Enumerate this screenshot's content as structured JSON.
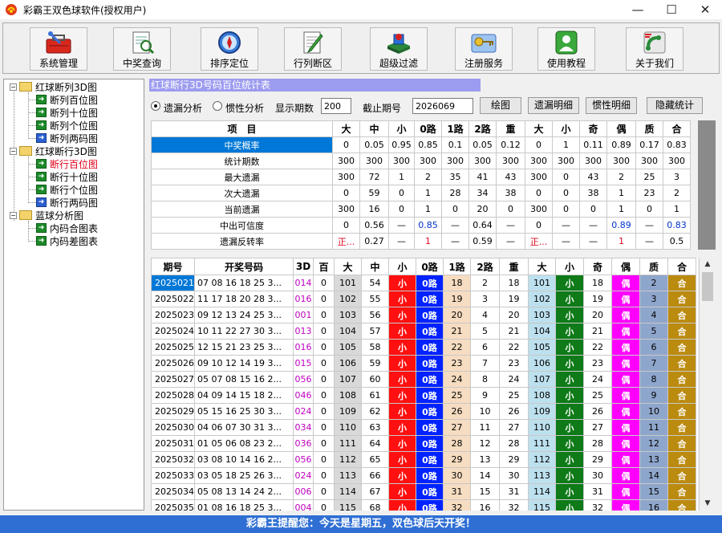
{
  "window": {
    "title": "彩霸王双色球软件(授权用户)",
    "minimize_glyph": "—",
    "maximize_glyph": "☐",
    "close_glyph": "✕"
  },
  "toolbar": {
    "items": [
      {
        "label": "系统管理",
        "icon": "toolbox-icon"
      },
      {
        "label": "中奖查询",
        "icon": "search-document-icon"
      },
      {
        "label": "排序定位",
        "icon": "compass-icon"
      },
      {
        "label": "行列断区",
        "icon": "edit-document-icon"
      },
      {
        "label": "超级过滤",
        "icon": "filter-blocks-icon"
      },
      {
        "label": "注册服务",
        "icon": "key-icon"
      },
      {
        "label": "使用教程",
        "icon": "user-icon"
      },
      {
        "label": "关于我们",
        "icon": "phone-icon"
      }
    ]
  },
  "tree": {
    "groups": [
      {
        "label": "红球断列3D图",
        "expand": "−",
        "items": [
          "断列百位图",
          "断列十位图",
          "断列个位图",
          "断列两码图"
        ]
      },
      {
        "label": "红球断行3D图",
        "expand": "−",
        "items": [
          "断行百位图",
          "断行十位图",
          "断行个位图",
          "断行两码图"
        ]
      },
      {
        "label": "蓝球分析图",
        "expand": "−",
        "items": [
          "内码合图表",
          "内码差图表"
        ]
      }
    ],
    "selected": "断行百位图"
  },
  "banner": "红球断行3D号码百位统计表",
  "options": {
    "radio1": "遗漏分析",
    "radio2": "惯性分析",
    "selected": "遗漏分析",
    "count_label": "显示期数",
    "count_value": "200",
    "period_label": "截止期号",
    "period_value": "2026069",
    "buttons": [
      "绘图",
      "遗漏明细",
      "惯性明细",
      "隐藏统计"
    ]
  },
  "stat": {
    "headers": [
      "项　目",
      "大",
      "中",
      "小",
      "0路",
      "1路",
      "2路",
      "重",
      "大",
      "小",
      "奇",
      "偶",
      "质",
      "合"
    ],
    "rows": [
      [
        "中奖概率",
        "0",
        "0.05",
        "0.95",
        "0.85",
        "0.1",
        "0.05",
        "0.12",
        "0",
        "1",
        "0.11",
        "0.89",
        "0.17",
        "0.83"
      ],
      [
        "统计期数",
        "300",
        "300",
        "300",
        "300",
        "300",
        "300",
        "300",
        "300",
        "300",
        "300",
        "300",
        "300",
        "300"
      ],
      [
        "最大遗漏",
        "300",
        "72",
        "1",
        "2",
        "35",
        "41",
        "43",
        "300",
        "0",
        "43",
        "2",
        "25",
        "3"
      ],
      [
        "次大遗漏",
        "0",
        "59",
        "0",
        "1",
        "28",
        "34",
        "38",
        "0",
        "0",
        "38",
        "1",
        "23",
        "2"
      ],
      [
        "当前遗漏",
        "300",
        "16",
        "0",
        "1",
        "0",
        "20",
        "0",
        "300",
        "0",
        "0",
        "1",
        "0",
        "1"
      ],
      [
        "中出可信度",
        "0",
        "0.56",
        "—",
        "0.85",
        "—",
        "0.64",
        "—",
        "0",
        "—",
        "—",
        "0.89",
        "—",
        "0.83"
      ],
      [
        "遗漏反转率",
        "正...",
        "0.27",
        "—",
        "1",
        "—",
        "0.59",
        "—",
        "正...",
        "—",
        "—",
        "1",
        "—",
        "0.5"
      ]
    ]
  },
  "data": {
    "headers": [
      "期号",
      "开奖号码",
      "3D",
      "百",
      "大",
      "中",
      "小",
      "0路",
      "1路",
      "2路",
      "重",
      "大",
      "小",
      "奇",
      "偶",
      "质",
      "合"
    ],
    "rows": [
      [
        "2025021",
        "07 08 16 18 25 3...",
        "014",
        "0",
        "101",
        "54",
        "小",
        "0路",
        "18",
        "2",
        "18",
        "101",
        "小",
        "18",
        "偶",
        "2",
        "合"
      ],
      [
        "2025022",
        "11 17 18 20 28 3...",
        "016",
        "0",
        "102",
        "55",
        "小",
        "0路",
        "19",
        "3",
        "19",
        "102",
        "小",
        "19",
        "偶",
        "3",
        "合"
      ],
      [
        "2025023",
        "09 12 13 24 25 3...",
        "001",
        "0",
        "103",
        "56",
        "小",
        "0路",
        "20",
        "4",
        "20",
        "103",
        "小",
        "20",
        "偶",
        "4",
        "合"
      ],
      [
        "2025024",
        "10 11 22 27 30 3...",
        "013",
        "0",
        "104",
        "57",
        "小",
        "0路",
        "21",
        "5",
        "21",
        "104",
        "小",
        "21",
        "偶",
        "5",
        "合"
      ],
      [
        "2025025",
        "12 15 21 23 25 3...",
        "016",
        "0",
        "105",
        "58",
        "小",
        "0路",
        "22",
        "6",
        "22",
        "105",
        "小",
        "22",
        "偶",
        "6",
        "合"
      ],
      [
        "2025026",
        "09 10 12 14 19 3...",
        "015",
        "0",
        "106",
        "59",
        "小",
        "0路",
        "23",
        "7",
        "23",
        "106",
        "小",
        "23",
        "偶",
        "7",
        "合"
      ],
      [
        "2025027",
        "05 07 08 15 16 2...",
        "056",
        "0",
        "107",
        "60",
        "小",
        "0路",
        "24",
        "8",
        "24",
        "107",
        "小",
        "24",
        "偶",
        "8",
        "合"
      ],
      [
        "2025028",
        "04 09 14 15 18 2...",
        "046",
        "0",
        "108",
        "61",
        "小",
        "0路",
        "25",
        "9",
        "25",
        "108",
        "小",
        "25",
        "偶",
        "9",
        "合"
      ],
      [
        "2025029",
        "05 15 16 25 30 3...",
        "024",
        "0",
        "109",
        "62",
        "小",
        "0路",
        "26",
        "10",
        "26",
        "109",
        "小",
        "26",
        "偶",
        "10",
        "合"
      ],
      [
        "2025030",
        "04 06 07 30 31 3...",
        "034",
        "0",
        "110",
        "63",
        "小",
        "0路",
        "27",
        "11",
        "27",
        "110",
        "小",
        "27",
        "偶",
        "11",
        "合"
      ],
      [
        "2025031",
        "01 05 06 08 23 2...",
        "036",
        "0",
        "111",
        "64",
        "小",
        "0路",
        "28",
        "12",
        "28",
        "111",
        "小",
        "28",
        "偶",
        "12",
        "合"
      ],
      [
        "2025032",
        "03 08 10 14 16 2...",
        "056",
        "0",
        "112",
        "65",
        "小",
        "0路",
        "29",
        "13",
        "29",
        "112",
        "小",
        "29",
        "偶",
        "13",
        "合"
      ],
      [
        "2025033",
        "03 05 18 25 26 3...",
        "024",
        "0",
        "113",
        "66",
        "小",
        "0路",
        "30",
        "14",
        "30",
        "113",
        "小",
        "30",
        "偶",
        "14",
        "合"
      ],
      [
        "2025034",
        "05 08 13 14 24 2...",
        "006",
        "0",
        "114",
        "67",
        "小",
        "0路",
        "31",
        "15",
        "31",
        "114",
        "小",
        "31",
        "偶",
        "15",
        "合"
      ],
      [
        "2025035",
        "01 08 16 18 25 3...",
        "004",
        "0",
        "115",
        "68",
        "小",
        "0路",
        "32",
        "16",
        "32",
        "115",
        "小",
        "32",
        "偶",
        "16",
        "合"
      ]
    ]
  },
  "status": "彩霸王提醒您：今天是星期五，双色球后天开奖！"
}
